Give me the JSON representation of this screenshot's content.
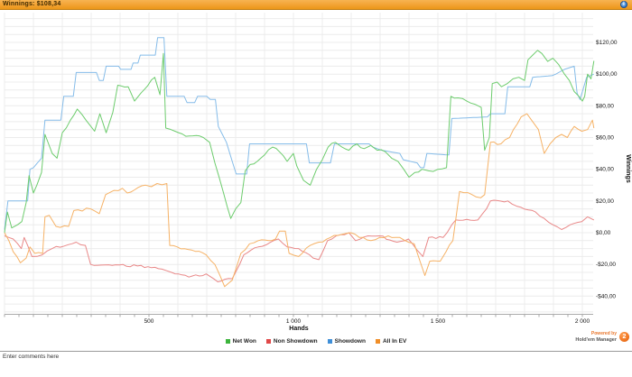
{
  "titlebar": {
    "label": "Winnings: $108,34"
  },
  "info_button": {
    "glyph": "i"
  },
  "comments": {
    "placeholder": "Enter comments here"
  },
  "footer": {
    "powered_by": "Powered by",
    "brand": "Hold'em Manager",
    "logo_text": "2"
  },
  "colors": {
    "titlebar_orange": "#f2a233",
    "grid": "#ececec",
    "axis": "#aaaaaa"
  },
  "chart_data": {
    "type": "line",
    "title": "Winnings: $108,34",
    "xlabel": "Hands",
    "ylabel": "Winnings",
    "xlim": [
      0,
      2040
    ],
    "ylim": [
      -51,
      139
    ],
    "grid": true,
    "legend_position": "bottom",
    "x_ticks": [
      {
        "value": 500,
        "label": "500"
      },
      {
        "value": 1000,
        "label": "1 000"
      },
      {
        "value": 1500,
        "label": "1 500"
      },
      {
        "value": 2000,
        "label": "2 000"
      }
    ],
    "y_ticks": [
      {
        "value": 120,
        "label": "$120,00"
      },
      {
        "value": 100,
        "label": "$100,00"
      },
      {
        "value": 80,
        "label": "$80,00"
      },
      {
        "value": 60,
        "label": "$60,00"
      },
      {
        "value": 40,
        "label": "$40,00"
      },
      {
        "value": 20,
        "label": "$20,00"
      },
      {
        "value": 0,
        "label": "$0,00"
      },
      {
        "value": -20,
        "label": "-$20,00"
      },
      {
        "value": -40,
        "label": "-$40,00"
      }
    ],
    "series": [
      {
        "name": "Net Won",
        "legend_color": "#3cb43c",
        "line_color": "#6dcc6d",
        "points": [
          [
            0,
            0
          ],
          [
            10,
            13
          ],
          [
            25,
            3
          ],
          [
            45,
            5
          ],
          [
            60,
            7
          ],
          [
            75,
            19
          ],
          [
            85,
            36
          ],
          [
            100,
            25
          ],
          [
            112,
            30
          ],
          [
            128,
            38
          ],
          [
            140,
            62
          ],
          [
            165,
            50
          ],
          [
            182,
            47
          ],
          [
            200,
            63
          ],
          [
            228,
            71
          ],
          [
            252,
            78
          ],
          [
            282,
            71
          ],
          [
            312,
            64
          ],
          [
            330,
            75
          ],
          [
            352,
            63
          ],
          [
            375,
            76
          ],
          [
            392,
            93
          ],
          [
            428,
            92
          ],
          [
            450,
            83
          ],
          [
            472,
            88
          ],
          [
            520,
            98
          ],
          [
            538,
            87
          ],
          [
            550,
            113
          ],
          [
            558,
            66
          ],
          [
            590,
            64
          ],
          [
            640,
            61
          ],
          [
            688,
            60
          ],
          [
            710,
            57
          ],
          [
            728,
            44
          ],
          [
            758,
            25
          ],
          [
            783,
            9
          ],
          [
            800,
            15
          ],
          [
            818,
            19
          ],
          [
            833,
            39
          ],
          [
            850,
            43
          ],
          [
            875,
            45
          ],
          [
            900,
            49
          ],
          [
            928,
            54
          ],
          [
            952,
            51
          ],
          [
            978,
            45
          ],
          [
            1000,
            50
          ],
          [
            1012,
            42
          ],
          [
            1035,
            33
          ],
          [
            1058,
            30
          ],
          [
            1080,
            40
          ],
          [
            1100,
            46
          ],
          [
            1120,
            54
          ],
          [
            1145,
            57
          ],
          [
            1168,
            54
          ],
          [
            1192,
            52
          ],
          [
            1220,
            56
          ],
          [
            1245,
            53
          ],
          [
            1268,
            55
          ],
          [
            1290,
            52
          ],
          [
            1318,
            51
          ],
          [
            1340,
            47
          ],
          [
            1362,
            45
          ],
          [
            1382,
            40
          ],
          [
            1400,
            35
          ],
          [
            1420,
            38
          ],
          [
            1445,
            40
          ],
          [
            1468,
            39
          ],
          [
            1500,
            40
          ],
          [
            1530,
            41
          ],
          [
            1545,
            86
          ],
          [
            1570,
            85
          ],
          [
            1600,
            83
          ],
          [
            1628,
            81
          ],
          [
            1650,
            79
          ],
          [
            1662,
            52
          ],
          [
            1678,
            60
          ],
          [
            1688,
            94
          ],
          [
            1705,
            95
          ],
          [
            1720,
            92
          ],
          [
            1740,
            94
          ],
          [
            1760,
            97
          ],
          [
            1780,
            98
          ],
          [
            1800,
            96
          ],
          [
            1812,
            109
          ],
          [
            1828,
            112
          ],
          [
            1845,
            115
          ],
          [
            1860,
            113
          ],
          [
            1880,
            108
          ],
          [
            1898,
            110
          ],
          [
            1918,
            106
          ],
          [
            1938,
            100
          ],
          [
            1955,
            96
          ],
          [
            1972,
            89
          ],
          [
            1988,
            86
          ],
          [
            2000,
            83
          ],
          [
            2008,
            86
          ],
          [
            2018,
            100
          ],
          [
            2030,
            97
          ],
          [
            2040,
            108.34
          ]
        ]
      },
      {
        "name": "Non Showdown",
        "legend_color": "#e04848",
        "line_color": "#e98888",
        "points": [
          [
            0,
            -2
          ],
          [
            30,
            -4
          ],
          [
            58,
            -10
          ],
          [
            68,
            -3
          ],
          [
            80,
            -8
          ],
          [
            95,
            -15
          ],
          [
            130,
            -14
          ],
          [
            165,
            -10
          ],
          [
            248,
            -6
          ],
          [
            280,
            -8
          ],
          [
            298,
            -20
          ],
          [
            460,
            -21
          ],
          [
            545,
            -23
          ],
          [
            578,
            -25
          ],
          [
            638,
            -28
          ],
          [
            698,
            -26
          ],
          [
            738,
            -31
          ],
          [
            788,
            -29
          ],
          [
            828,
            -14
          ],
          [
            878,
            -9
          ],
          [
            948,
            -4
          ],
          [
            978,
            -9
          ],
          [
            1018,
            -10
          ],
          [
            1068,
            -16
          ],
          [
            1088,
            -17
          ],
          [
            1118,
            -5
          ],
          [
            1148,
            -2
          ],
          [
            1192,
            0
          ],
          [
            1215,
            -5
          ],
          [
            1258,
            -2
          ],
          [
            1298,
            -2
          ],
          [
            1358,
            -6
          ],
          [
            1398,
            -4
          ],
          [
            1428,
            -11
          ],
          [
            1448,
            -15
          ],
          [
            1468,
            -3
          ],
          [
            1518,
            -3
          ],
          [
            1548,
            5
          ],
          [
            1562,
            8
          ],
          [
            1638,
            8
          ],
          [
            1668,
            15
          ],
          [
            1682,
            20
          ],
          [
            1742,
            20
          ],
          [
            1788,
            16
          ],
          [
            1838,
            13
          ],
          [
            1868,
            9
          ],
          [
            1898,
            5
          ],
          [
            1928,
            2
          ],
          [
            1958,
            5
          ],
          [
            1998,
            7
          ],
          [
            2018,
            10
          ],
          [
            2040,
            8
          ]
        ]
      },
      {
        "name": "Showdown",
        "legend_color": "#3f8fd8",
        "line_color": "#85bce9",
        "points": [
          [
            0,
            2
          ],
          [
            12,
            20
          ],
          [
            80,
            20
          ],
          [
            88,
            40
          ],
          [
            100,
            41
          ],
          [
            128,
            47
          ],
          [
            140,
            71
          ],
          [
            195,
            71
          ],
          [
            205,
            86
          ],
          [
            238,
            86
          ],
          [
            248,
            101
          ],
          [
            318,
            101
          ],
          [
            328,
            96
          ],
          [
            342,
            96
          ],
          [
            352,
            105
          ],
          [
            395,
            105
          ],
          [
            402,
            103
          ],
          [
            438,
            103
          ],
          [
            445,
            107
          ],
          [
            462,
            107
          ],
          [
            470,
            112
          ],
          [
            522,
            112
          ],
          [
            530,
            123
          ],
          [
            552,
            123
          ],
          [
            562,
            86
          ],
          [
            622,
            86
          ],
          [
            632,
            82
          ],
          [
            658,
            82
          ],
          [
            668,
            86
          ],
          [
            700,
            86
          ],
          [
            712,
            84
          ],
          [
            730,
            84
          ],
          [
            740,
            67
          ],
          [
            768,
            57
          ],
          [
            788,
            45
          ],
          [
            802,
            37
          ],
          [
            838,
            37
          ],
          [
            848,
            56
          ],
          [
            1045,
            56
          ],
          [
            1055,
            44
          ],
          [
            1128,
            44
          ],
          [
            1142,
            56
          ],
          [
            1262,
            56
          ],
          [
            1275,
            54
          ],
          [
            1305,
            52
          ],
          [
            1368,
            50
          ],
          [
            1380,
            46
          ],
          [
            1428,
            44
          ],
          [
            1440,
            41
          ],
          [
            1452,
            41
          ],
          [
            1462,
            50
          ],
          [
            1538,
            49
          ],
          [
            1548,
            72
          ],
          [
            1672,
            73
          ],
          [
            1682,
            75
          ],
          [
            1732,
            75
          ],
          [
            1742,
            92
          ],
          [
            1818,
            92
          ],
          [
            1828,
            98
          ],
          [
            1895,
            99
          ],
          [
            1908,
            100
          ],
          [
            1938,
            103
          ],
          [
            1972,
            105
          ],
          [
            1982,
            88
          ],
          [
            1992,
            84
          ],
          [
            2002,
            90
          ],
          [
            2015,
            98
          ],
          [
            2040,
            100
          ]
        ]
      },
      {
        "name": "All In EV",
        "legend_color": "#f08e28",
        "line_color": "#f6b266",
        "points": [
          [
            0,
            0
          ],
          [
            15,
            -5
          ],
          [
            30,
            -12
          ],
          [
            55,
            -19
          ],
          [
            75,
            -16
          ],
          [
            88,
            -9
          ],
          [
            105,
            -13
          ],
          [
            132,
            -13
          ],
          [
            140,
            10
          ],
          [
            155,
            11
          ],
          [
            178,
            4
          ],
          [
            222,
            4
          ],
          [
            240,
            14
          ],
          [
            298,
            15
          ],
          [
            328,
            12
          ],
          [
            350,
            24
          ],
          [
            408,
            28
          ],
          [
            425,
            25
          ],
          [
            450,
            27
          ],
          [
            488,
            30
          ],
          [
            508,
            29
          ],
          [
            528,
            31
          ],
          [
            562,
            31
          ],
          [
            572,
            -8
          ],
          [
            598,
            -9
          ],
          [
            648,
            -11
          ],
          [
            698,
            -14
          ],
          [
            728,
            -20
          ],
          [
            762,
            -34
          ],
          [
            788,
            -30
          ],
          [
            818,
            -13
          ],
          [
            848,
            -7
          ],
          [
            878,
            -5
          ],
          [
            938,
            -4
          ],
          [
            952,
            1
          ],
          [
            972,
            1
          ],
          [
            985,
            -13
          ],
          [
            1018,
            -15
          ],
          [
            1058,
            -8
          ],
          [
            1088,
            -6
          ],
          [
            1128,
            -3
          ],
          [
            1168,
            -1
          ],
          [
            1198,
            0
          ],
          [
            1228,
            -3
          ],
          [
            1268,
            -5
          ],
          [
            1298,
            -3
          ],
          [
            1328,
            -2
          ],
          [
            1368,
            -3
          ],
          [
            1398,
            -6
          ],
          [
            1418,
            -7
          ],
          [
            1438,
            -18
          ],
          [
            1455,
            -27
          ],
          [
            1472,
            -18
          ],
          [
            1508,
            -18
          ],
          [
            1528,
            -12
          ],
          [
            1552,
            -5
          ],
          [
            1575,
            26
          ],
          [
            1618,
            24
          ],
          [
            1648,
            22
          ],
          [
            1662,
            24
          ],
          [
            1682,
            57
          ],
          [
            1718,
            56
          ],
          [
            1748,
            60
          ],
          [
            1788,
            73
          ],
          [
            1808,
            75
          ],
          [
            1828,
            70
          ],
          [
            1848,
            65
          ],
          [
            1868,
            50
          ],
          [
            1888,
            56
          ],
          [
            1908,
            60
          ],
          [
            1928,
            62
          ],
          [
            1948,
            60
          ],
          [
            1972,
            67
          ],
          [
            1998,
            64
          ],
          [
            2018,
            65
          ],
          [
            2035,
            71
          ],
          [
            2040,
            66
          ]
        ]
      }
    ]
  }
}
